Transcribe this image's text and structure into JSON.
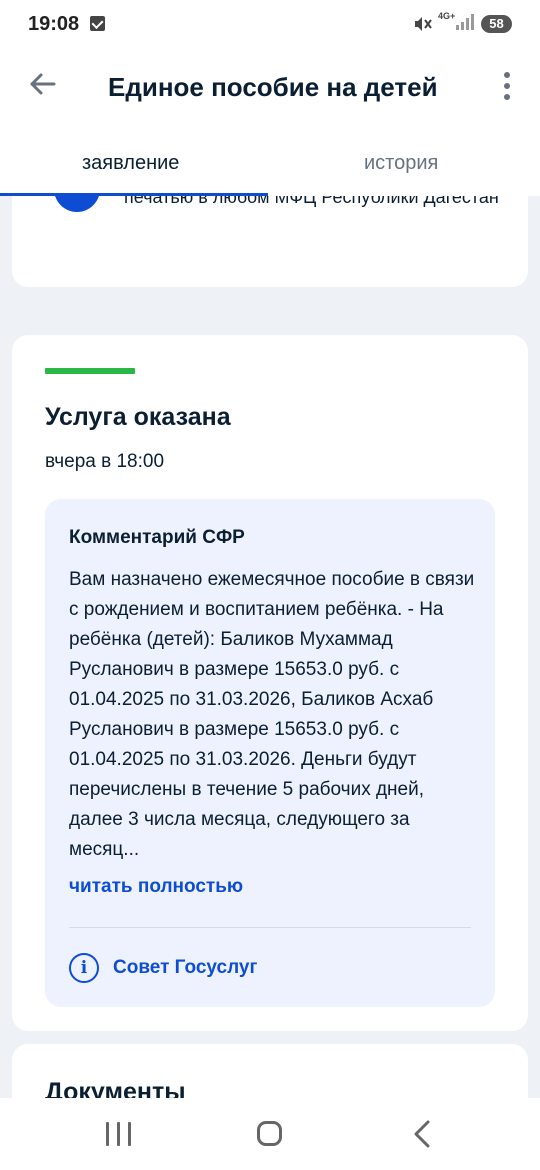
{
  "status_bar": {
    "time": "19:08",
    "network": "4G+",
    "battery": "58",
    "icons": [
      "check-icon",
      "mute-icon",
      "signal-icon",
      "battery-icon"
    ]
  },
  "app_bar": {
    "title": "Единое пособие на детей",
    "back_icon": "arrow-left-icon",
    "menu_icon": "more-vertical-icon"
  },
  "tabs": [
    {
      "label": "заявление",
      "active": true
    },
    {
      "label": "история",
      "active": false
    }
  ],
  "mfc_card": {
    "text": "Вы можете получить бумажный документ с печатью в любом МФЦ Республики Дагестан"
  },
  "status_card": {
    "status": "Услуга оказана",
    "status_color": "#2bb745",
    "when": "вчера в 18:00",
    "comment": {
      "title": "Комментарий СФР",
      "text": "Вам назначено ежемесячное пособие в связи с рождением и воспитанием ребёнка. - На ребёнка (детей): Баликов Мухаммад Русланович в размере 15653.0 руб. с 01.04.2025 по 31.03.2026, Баликов Асхаб Русланович в размере 15653.0 руб. с 01.04.2025 по 31.03.2026. Деньги будут перечислены в течение 5 рабочих дней, далее 3 числа месяца, следующего за месяц...",
      "read_more": "читать полностью"
    },
    "advice_label": "Совет Госуслуг"
  },
  "documents_card": {
    "title": "Документы"
  },
  "colors": {
    "accent": "#0d4cd3",
    "text": "#0b1f33",
    "secondary": "#66727f",
    "background": "#eef1f6",
    "comment_bg": "#edf2fe"
  }
}
